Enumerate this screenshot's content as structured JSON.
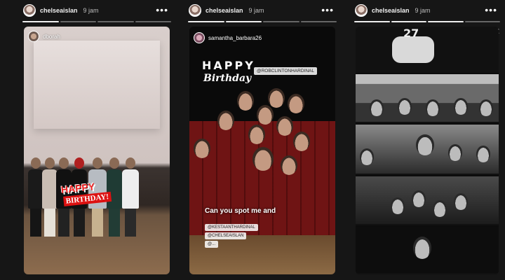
{
  "stories": [
    {
      "header": {
        "username": "chelseaislan",
        "time": "9 jam",
        "more_icon": "more-icon"
      },
      "progress": {
        "segments": 4,
        "completed": 1
      },
      "overlay": {
        "username": "dborah",
        "sticker_line1": "HAPPY",
        "sticker_line2": "BIRTHDAY!"
      }
    },
    {
      "header": {
        "username": "chelseaislan",
        "time": "9 jam",
        "more_icon": "more-icon"
      },
      "progress": {
        "segments": 4,
        "completed": 2
      },
      "overlay": {
        "username": "samantha_barbara26",
        "happy": "HAPPY",
        "birthday": "Birthday",
        "mention1": "@ROBCLINTONHARDINAL",
        "caption": "Can you spot me and",
        "mention2": "@KESTAANTHARDINAL",
        "mention3": "@CHELSEAISLAN",
        "mention4": "@..."
      }
    },
    {
      "header": {
        "username": "chelseaislan",
        "time": "9 jam",
        "more_icon": "more-icon"
      },
      "progress": {
        "segments": 4,
        "completed": 3
      },
      "overlay": {
        "cake_number": "27"
      }
    }
  ],
  "colors": {
    "background": "#161616",
    "text": "#ffffff",
    "sticker_red": "#e22222"
  }
}
